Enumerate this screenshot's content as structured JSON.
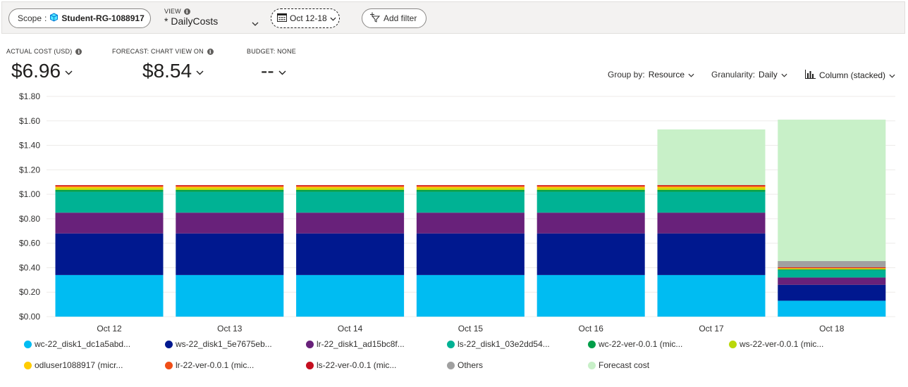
{
  "toolbar": {
    "scope_label": "Scope",
    "scope_sep": ":",
    "scope_value": "Student-RG-1088917",
    "view_label": "VIEW",
    "view_value": "* DailyCosts",
    "date_range": "Oct 12-18",
    "add_filter": "Add filter"
  },
  "kpis": [
    {
      "label": "ACTUAL COST (USD)",
      "value": "$6.96"
    },
    {
      "label": "FORECAST: CHART VIEW ON",
      "value": "$8.54"
    },
    {
      "label": "BUDGET: NONE",
      "value": "--"
    }
  ],
  "controls": {
    "group_label": "Group by:",
    "group_value": "Resource",
    "gran_label": "Granularity:",
    "gran_value": "Daily",
    "chart_type": "Column (stacked)"
  },
  "chart_data": {
    "type": "bar",
    "stacked": true,
    "categories": [
      "Oct 12",
      "Oct 13",
      "Oct 14",
      "Oct 15",
      "Oct 16",
      "Oct 17",
      "Oct 18"
    ],
    "ylim": [
      0,
      1.8
    ],
    "yticks": [
      "$0.00",
      "$0.20",
      "$0.40",
      "$0.60",
      "$0.80",
      "$1.00",
      "$1.20",
      "$1.40",
      "$1.60",
      "$1.80"
    ],
    "ytick_values": [
      0,
      0.2,
      0.4,
      0.6,
      0.8,
      1.0,
      1.2,
      1.4,
      1.6,
      1.8
    ],
    "grid": true,
    "legend_position": "bottom",
    "series": [
      {
        "name": "wc-22_disk1_dc1a5abd...",
        "color": "#00bcf2",
        "values": [
          0.34,
          0.34,
          0.34,
          0.34,
          0.34,
          0.34,
          0.13
        ]
      },
      {
        "name": "ws-22_disk1_5e7675eb...",
        "color": "#00188f",
        "values": [
          0.34,
          0.34,
          0.34,
          0.34,
          0.34,
          0.34,
          0.13
        ]
      },
      {
        "name": "lr-22_disk1_ad15bc8f...",
        "color": "#68217a",
        "values": [
          0.17,
          0.17,
          0.17,
          0.17,
          0.17,
          0.17,
          0.06
        ]
      },
      {
        "name": "ls-22_disk1_03e2dd54...",
        "color": "#00b294",
        "values": [
          0.17,
          0.17,
          0.17,
          0.17,
          0.17,
          0.17,
          0.06
        ]
      },
      {
        "name": "wc-22-ver-0.0.1 (mic...",
        "color": "#009e49",
        "values": [
          0.015,
          0.015,
          0.015,
          0.015,
          0.015,
          0.015,
          0.006
        ]
      },
      {
        "name": "ws-22-ver-0.0.1 (mic...",
        "color": "#bad80a",
        "values": [
          0.015,
          0.015,
          0.015,
          0.015,
          0.015,
          0.015,
          0.006
        ]
      },
      {
        "name": "odluser1088917 (micr...",
        "color": "#ffcc00",
        "values": [
          0.01,
          0.01,
          0.01,
          0.01,
          0.01,
          0.01,
          0.004
        ]
      },
      {
        "name": "lr-22-ver-0.0.1 (mic...",
        "color": "#f04e17",
        "values": [
          0.01,
          0.01,
          0.01,
          0.01,
          0.01,
          0.01,
          0.004
        ]
      },
      {
        "name": "ls-22-ver-0.0.1 (mic...",
        "color": "#c50f1f",
        "values": [
          0.005,
          0.005,
          0.005,
          0.005,
          0.005,
          0.005,
          0.004
        ]
      },
      {
        "name": "Others",
        "color": "#a0a0a0",
        "values": [
          0,
          0,
          0,
          0,
          0,
          0,
          0.05
        ]
      }
    ],
    "forecast": {
      "name": "Forecast cost",
      "color": "#c8f0c8",
      "totals": [
        null,
        null,
        null,
        null,
        null,
        1.53,
        1.61
      ]
    }
  }
}
